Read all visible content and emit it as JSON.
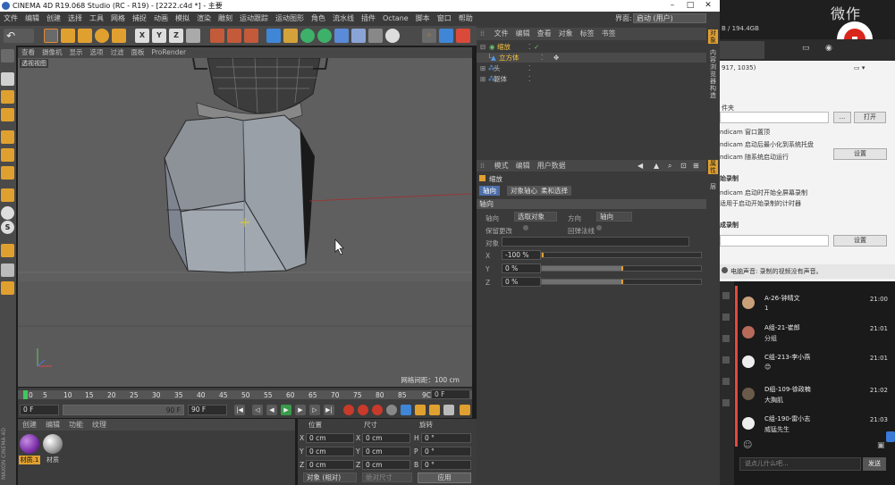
{
  "app": {
    "title": "CINEMA 4D R19.068 Studio (RC - R19) - [2222.c4d *] - 主要",
    "min": "–",
    "max": "□",
    "close": "✕"
  },
  "menu": [
    "文件",
    "编辑",
    "创建",
    "选择",
    "工具",
    "网格",
    "捕捉",
    "动画",
    "模拟",
    "渲染",
    "雕刻",
    "运动跟踪",
    "运动图形",
    "角色",
    "流水线",
    "插件",
    "Octane",
    "脚本",
    "窗口",
    "帮助"
  ],
  "layout": {
    "label": "界面:",
    "value": "启动 (用户)"
  },
  "viewport": {
    "menu": [
      "查看",
      "摄像机",
      "显示",
      "选项",
      "过滤",
      "面板",
      "ProRender"
    ],
    "label": "透视视图",
    "grid": "网格间距：100 cm"
  },
  "timeline": {
    "ticks": [
      "0",
      "5",
      "10",
      "15",
      "20",
      "25",
      "30",
      "35",
      "40",
      "45",
      "50",
      "55",
      "60",
      "65",
      "70",
      "75",
      "80",
      "85",
      "9C"
    ],
    "frame": "0 F"
  },
  "transport": {
    "start": "0 F",
    "end_slider": "90 F",
    "end": "90 F"
  },
  "materials": {
    "menu": [
      "创建",
      "编辑",
      "功能",
      "纹理"
    ],
    "items": [
      {
        "name": "材质.1",
        "color": "#7b2fa8"
      },
      {
        "name": "材质",
        "color": "#9a9a9a"
      }
    ]
  },
  "coords": {
    "headers": [
      "位置",
      "尺寸",
      "旋转"
    ],
    "rows": [
      {
        "axis": "X",
        "pos": "0 cm",
        "size_axis": "X",
        "size": "0 cm",
        "rot_axis": "H",
        "rot": "0 °"
      },
      {
        "axis": "Y",
        "pos": "0 cm",
        "size_axis": "Y",
        "size": "0 cm",
        "rot_axis": "P",
        "rot": "0 °"
      },
      {
        "axis": "Z",
        "pos": "0 cm",
        "size_axis": "Z",
        "size": "0 cm",
        "rot_axis": "B",
        "rot": "0 °"
      }
    ],
    "mode": "对象 (相对)",
    "size_mode": "绝对尺寸",
    "apply": "应用"
  },
  "objects": {
    "menu": [
      "文件",
      "编辑",
      "查看",
      "对象",
      "标签",
      "书签"
    ],
    "items": [
      {
        "name": "缩放",
        "indent": 0,
        "color": "#f0c040"
      },
      {
        "name": "立方体",
        "indent": 1,
        "color": "#f0c040"
      },
      {
        "name": "头",
        "indent": 0,
        "color": "#c8c8c8"
      },
      {
        "name": "躯体",
        "indent": 0,
        "color": "#c8c8c8"
      }
    ]
  },
  "attributes": {
    "menu": [
      "模式",
      "编辑",
      "用户数据"
    ],
    "object": "缩放",
    "tabs": [
      "轴向",
      "对象轴心",
      "柔和选择"
    ],
    "section": "轴向",
    "axis_label": "轴向",
    "axis_value": "选取对象",
    "dir_label": "方向",
    "dir_value": "轴向",
    "keep_label": "保留更改",
    "sym_label": "回弹法线",
    "obj_label": "对象",
    "x": {
      "label": "X",
      "value": "-100 %",
      "fill": 0
    },
    "y": {
      "label": "Y",
      "value": "0 %",
      "fill": 0.5
    },
    "z": {
      "label": "Z",
      "value": "0 %",
      "fill": 0.5
    }
  },
  "right_tabs": [
    "对象",
    "内容浏览器",
    "构造",
    "属性",
    "层"
  ],
  "bandicam": {
    "size": "B / 194.4GB",
    "coords": "917, 1035)",
    "rec_watermark": "微作",
    "items": [
      {
        "text": "件夹"
      },
      {
        "text": "ndicam 窗口置顶"
      },
      {
        "text": "ndicam 启动后最小化到系统托盘"
      },
      {
        "text": "ndicam 随系统启动运行"
      },
      {
        "text": "始录制"
      },
      {
        "text": "ndicam 启动时开始全屏幕录制"
      },
      {
        "text": "适用于启动开始录制的计时器"
      },
      {
        "text": "成录制"
      },
      {
        "text": "电脑声音: 录制的视频没有声音。"
      }
    ],
    "open": "打开",
    "settings": "设置",
    "settings2": "设置"
  },
  "chat": {
    "input_placeholder": "说点儿什么吧...",
    "send": "发送",
    "messages": [
      {
        "name": "A-26-钟晴文",
        "msg": "1",
        "time": "21:00"
      },
      {
        "name": "A组-21-崔郎",
        "msg": "分组",
        "time": "21:01"
      },
      {
        "name": "C组-213-李小燕",
        "msg": "😊",
        "time": "21:01"
      },
      {
        "name": "D组-109-徐政楠",
        "msg": "大胸肌",
        "time": "21:02"
      },
      {
        "name": "C组-190-雷小志",
        "msg": "威猛先生",
        "time": "21:03"
      }
    ]
  }
}
